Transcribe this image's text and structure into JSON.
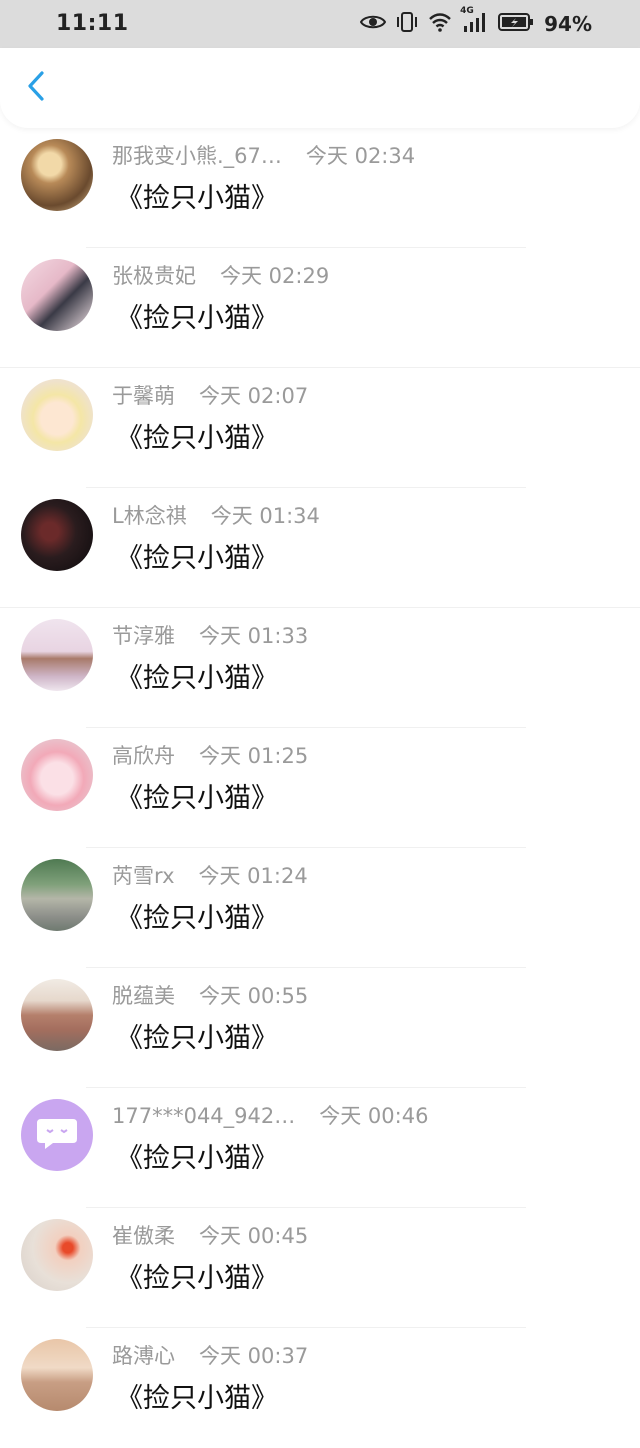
{
  "status_bar": {
    "time": "11:11",
    "network": "4G",
    "battery": "94%"
  },
  "nav": {
    "back_icon": "chevron-left-icon",
    "accent": "#2aa0e6"
  },
  "messages": [
    {
      "name": "那我变小熊._67…",
      "time": "今天 02:34",
      "text": "《捡只小猫》",
      "avatar": "anime-girl-avatar"
    },
    {
      "name": "张极贵妃",
      "time": "今天 02:29",
      "text": "《捡只小猫》",
      "avatar": "boy-photo-avatar"
    },
    {
      "name": "于馨萌",
      "time": "今天 02:07",
      "text": "《捡只小猫》",
      "avatar": "anime-chibi-avatar"
    },
    {
      "name": "L林念祺",
      "time": "今天 01:34",
      "text": "《捡只小猫》",
      "avatar": "dark-photo-avatar"
    },
    {
      "name": "节淳雅",
      "time": "今天 01:33",
      "text": "《捡只小猫》",
      "avatar": "plush-toys-avatar"
    },
    {
      "name": "高欣舟",
      "time": "今天 01:25",
      "text": "《捡只小猫》",
      "avatar": "pink-anime-avatar"
    },
    {
      "name": "芮雪rx",
      "time": "今天 01:24",
      "text": "《捡只小猫》",
      "avatar": "outdoor-group-avatar"
    },
    {
      "name": "脱蕴美",
      "time": "今天 00:55",
      "text": "《捡只小猫》",
      "avatar": "vintage-van-avatar"
    },
    {
      "name": "177***044_942…",
      "time": "今天 00:46",
      "text": "《捡只小猫》",
      "avatar": "default-chat-avatar"
    },
    {
      "name": "崔傲柔",
      "time": "今天 00:45",
      "text": "《捡只小猫》",
      "avatar": "hand-flower-avatar"
    },
    {
      "name": "路溥心",
      "time": "今天 00:37",
      "text": "《捡只小猫》",
      "avatar": "beach-silhouette-avatar"
    }
  ]
}
